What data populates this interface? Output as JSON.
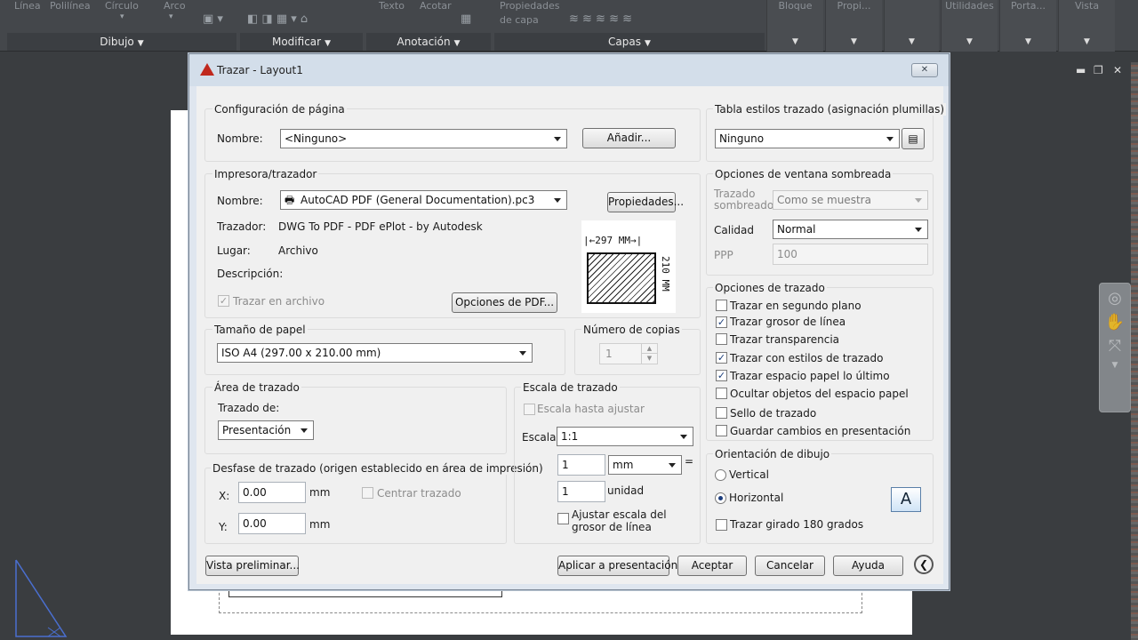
{
  "ribbon": {
    "top_labels": [
      "Línea",
      "Polilínea",
      "Círculo",
      "Arco",
      "Texto",
      "Acotar",
      "Propiedades",
      "de capa"
    ],
    "right_panels": [
      "Bloque",
      "Propi...",
      "",
      "",
      "Utilidades",
      "Porta...",
      "Vista"
    ],
    "panels": [
      {
        "label": "Dibujo"
      },
      {
        "label": "Modificar"
      },
      {
        "label": "Anotación"
      },
      {
        "label": "Capas"
      }
    ]
  },
  "dialog": {
    "title": "Trazar - Layout1",
    "close_label": "✕",
    "page_setup": {
      "group_label": "Configuración de página",
      "name_label": "Nombre:",
      "name_value": "<Ninguno>",
      "add_button": "Añadir..."
    },
    "printer": {
      "group_label": "Impresora/trazador",
      "name_label": "Nombre:",
      "name_value": "AutoCAD PDF (General Documentation).pc3",
      "properties_button": "Propiedades...",
      "plotter_label": "Trazador:",
      "plotter_value": "DWG To PDF - PDF ePlot - by Autodesk",
      "where_label": "Lugar:",
      "where_value": "Archivo",
      "description_label": "Descripción:",
      "plot_to_file_label": "Trazar en archivo",
      "pdf_options_button": "Opciones de PDF...",
      "preview_width": "297 MM",
      "preview_height": "210 MM"
    },
    "paper_size": {
      "group_label": "Tamaño de papel",
      "value": "ISO A4 (297.00 x 210.00 mm)"
    },
    "copies": {
      "group_label": "Número de copias",
      "value": "1"
    },
    "plot_area": {
      "group_label": "Área de trazado",
      "what_label": "Trazado de:",
      "what_value": "Presentación"
    },
    "plot_offset": {
      "group_label": "Desfase de trazado (origen establecido en área de impresión)",
      "x_label": "X:",
      "x_value": "0.00",
      "x_unit": "mm",
      "y_label": "Y:",
      "y_value": "0.00",
      "y_unit": "mm",
      "center_label": "Centrar trazado"
    },
    "plot_scale": {
      "group_label": "Escala de trazado",
      "fit_label": "Escala hasta ajustar",
      "scale_label": "Escala:",
      "scale_value": "1:1",
      "value1": "1",
      "unit1": "mm",
      "equals": "=",
      "value2": "1",
      "unit2": "unidad",
      "lineweights_label": "Ajustar escala del grosor de línea"
    },
    "plot_style_table": {
      "group_label": "Tabla estilos trazado (asignación plumillas)",
      "value": "Ninguno"
    },
    "shaded_viewport": {
      "group_label": "Opciones de ventana sombreada",
      "shade_label": "Trazado sombreado",
      "shade_value": "Como se muestra",
      "quality_label": "Calidad",
      "quality_value": "Normal",
      "dpi_label": "PPP",
      "dpi_value": "100"
    },
    "plot_options": {
      "group_label": "Opciones de trazado",
      "items": [
        {
          "label": "Trazar en segundo plano",
          "checked": false
        },
        {
          "label": "Trazar grosor de línea",
          "checked": true
        },
        {
          "label": "Trazar transparencia",
          "checked": false
        },
        {
          "label": "Trazar con estilos de trazado",
          "checked": true
        },
        {
          "label": "Trazar espacio papel lo último",
          "checked": true
        },
        {
          "label": "Ocultar objetos del espacio papel",
          "checked": false
        },
        {
          "label": "Sello de trazado",
          "checked": false
        },
        {
          "label": "Guardar cambios en presentación",
          "checked": false
        }
      ]
    },
    "orientation": {
      "group_label": "Orientación de dibujo",
      "portrait_label": "Vertical",
      "landscape_label": "Horizontal",
      "selected": "Horizontal",
      "upside_down_label": "Trazar girado 180 grados",
      "icon_letter": "A"
    },
    "footer": {
      "preview_button": "Vista preliminar...",
      "apply_button": "Aplicar a presentación",
      "ok_button": "Aceptar",
      "cancel_button": "Cancelar",
      "help_button": "Ayuda"
    }
  }
}
